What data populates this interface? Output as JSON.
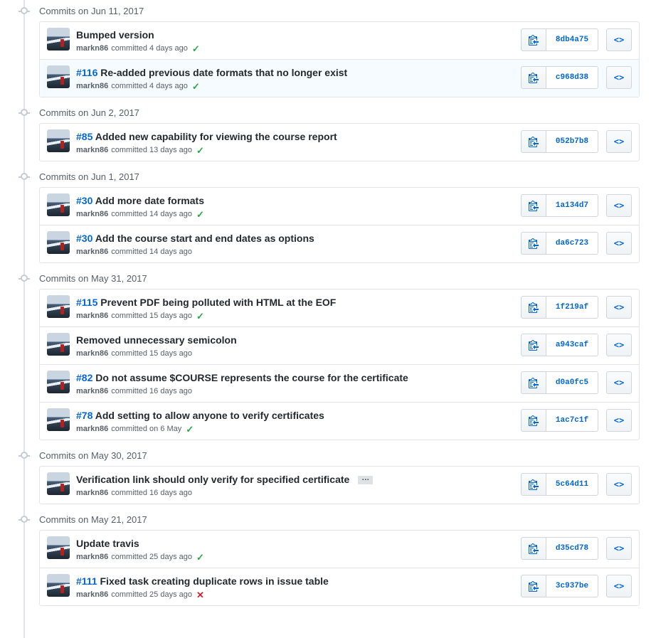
{
  "groups": [
    {
      "date": "Commits on Jun 11, 2017",
      "commits": [
        {
          "issue": "",
          "message": "Bumped version",
          "author": "markn86",
          "committed": "committed 4 days ago",
          "status": "success",
          "status_glyph": "✓",
          "sha": "8db4a75",
          "highlighted": false
        },
        {
          "issue": "#116",
          "message": "Re-added previous date formats that no longer exist",
          "author": "markn86",
          "committed": "committed 4 days ago",
          "status": "success",
          "status_glyph": "✓",
          "sha": "c968d38",
          "highlighted": true
        }
      ]
    },
    {
      "date": "Commits on Jun 2, 2017",
      "commits": [
        {
          "issue": "#85",
          "message": "Added new capability for viewing the course report",
          "author": "markn86",
          "committed": "committed 13 days ago",
          "status": "success",
          "status_glyph": "✓",
          "sha": "052b7b8",
          "highlighted": false
        }
      ]
    },
    {
      "date": "Commits on Jun 1, 2017",
      "commits": [
        {
          "issue": "#30",
          "message": "Add more date formats",
          "author": "markn86",
          "committed": "committed 14 days ago",
          "status": "success",
          "status_glyph": "✓",
          "sha": "1a134d7",
          "highlighted": false
        },
        {
          "issue": "#30",
          "message": "Add the course start and end dates as options",
          "author": "markn86",
          "committed": "committed 14 days ago",
          "status": "none",
          "status_glyph": "",
          "sha": "da6c723",
          "highlighted": false
        }
      ]
    },
    {
      "date": "Commits on May 31, 2017",
      "commits": [
        {
          "issue": "#115",
          "message": "Prevent PDF being polluted with HTML at the EOF",
          "author": "markn86",
          "committed": "committed 15 days ago",
          "status": "success",
          "status_glyph": "✓",
          "sha": "1f219af",
          "highlighted": false
        },
        {
          "issue": "",
          "message": "Removed unnecessary semicolon",
          "author": "markn86",
          "committed": "committed 15 days ago",
          "status": "none",
          "status_glyph": "",
          "sha": "a943caf",
          "highlighted": false
        },
        {
          "issue": "#82",
          "message": "Do not assume $COURSE represents the course for the certificate",
          "author": "markn86",
          "committed": "committed 16 days ago",
          "status": "none",
          "status_glyph": "",
          "sha": "d0a0fc5",
          "highlighted": false
        },
        {
          "issue": "#78",
          "message": "Add setting to allow anyone to verify certificates",
          "author": "markn86",
          "committed": "committed on 6 May",
          "status": "success",
          "status_glyph": "✓",
          "sha": "1ac7c1f",
          "highlighted": false
        }
      ]
    },
    {
      "date": "Commits on May 30, 2017",
      "commits": [
        {
          "issue": "",
          "message": "Verification link should only verify for specified certificate",
          "author": "markn86",
          "committed": "committed 16 days ago",
          "status": "none",
          "status_glyph": "",
          "sha": "5c64d11",
          "highlighted": false,
          "has_ellipsis": true,
          "ellipsis": "…"
        }
      ]
    },
    {
      "date": "Commits on May 21, 2017",
      "commits": [
        {
          "issue": "",
          "message": "Update travis",
          "author": "markn86",
          "committed": "committed 25 days ago",
          "status": "success",
          "status_glyph": "✓",
          "sha": "d35cd78",
          "highlighted": false
        },
        {
          "issue": "#111",
          "message": "Fixed task creating duplicate rows in issue table",
          "author": "markn86",
          "committed": "committed 25 days ago",
          "status": "failure",
          "status_glyph": "✕",
          "sha": "3c937be",
          "highlighted": false
        }
      ]
    }
  ],
  "icons": {
    "copy": "clipboard-icon",
    "browse": "code-icon",
    "browse_glyph": "<>"
  },
  "colors": {
    "link": "#0366d6",
    "success": "#28a745",
    "failure": "#cb2431",
    "border": "#e1e4e8",
    "highlight_bg": "#f6fbff"
  }
}
